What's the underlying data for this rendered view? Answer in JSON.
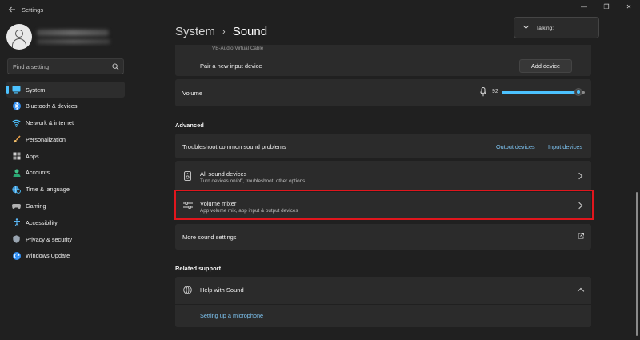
{
  "window": {
    "back_icon": "arrow-left-icon",
    "title": "Settings",
    "minimize_glyph": "—",
    "restore_glyph": "❐",
    "close_glyph": "✕"
  },
  "profile": {
    "avatar_icon": "person-icon"
  },
  "search": {
    "placeholder": "Find a setting",
    "icon": "search-icon"
  },
  "nav": {
    "items": [
      {
        "label": "System",
        "icon": "monitor-icon",
        "selected": true
      },
      {
        "label": "Bluetooth & devices",
        "icon": "bluetooth-icon"
      },
      {
        "label": "Network & internet",
        "icon": "wifi-icon"
      },
      {
        "label": "Personalization",
        "icon": "brush-icon"
      },
      {
        "label": "Apps",
        "icon": "apps-icon"
      },
      {
        "label": "Accounts",
        "icon": "person-icon"
      },
      {
        "label": "Time & language",
        "icon": "globe-clock-icon"
      },
      {
        "label": "Gaming",
        "icon": "gamepad-icon"
      },
      {
        "label": "Accessibility",
        "icon": "accessibility-icon"
      },
      {
        "label": "Privacy & security",
        "icon": "shield-icon"
      },
      {
        "label": "Windows Update",
        "icon": "update-icon"
      }
    ]
  },
  "breadcrumb": {
    "parent": "System",
    "separator": "›",
    "current": "Sound"
  },
  "toast": {
    "text": "Talking:"
  },
  "input_section": {
    "device_partial": "VB-Audio Virtual Cable",
    "pair_label": "Pair a new input device",
    "add_device_button": "Add device",
    "volume_label": "Volume",
    "volume_value": "92",
    "volume_percent": 92
  },
  "advanced": {
    "title": "Advanced",
    "troubleshoot_label": "Troubleshoot common sound problems",
    "output_devices_link": "Output devices",
    "input_devices_link": "Input devices",
    "all_sound_devices": {
      "label": "All sound devices",
      "sub": "Turn devices on/off, troubleshoot, other options"
    },
    "volume_mixer": {
      "label": "Volume mixer",
      "sub": "App volume mix, app input & output devices"
    },
    "more_settings_label": "More sound settings"
  },
  "related": {
    "title": "Related support",
    "help_label": "Help with Sound",
    "link_microphone": "Setting up a microphone"
  },
  "colors": {
    "accent": "#4cc2ff",
    "highlight_box": "#e0161d",
    "background": "#202020",
    "card": "#2b2b2b"
  }
}
